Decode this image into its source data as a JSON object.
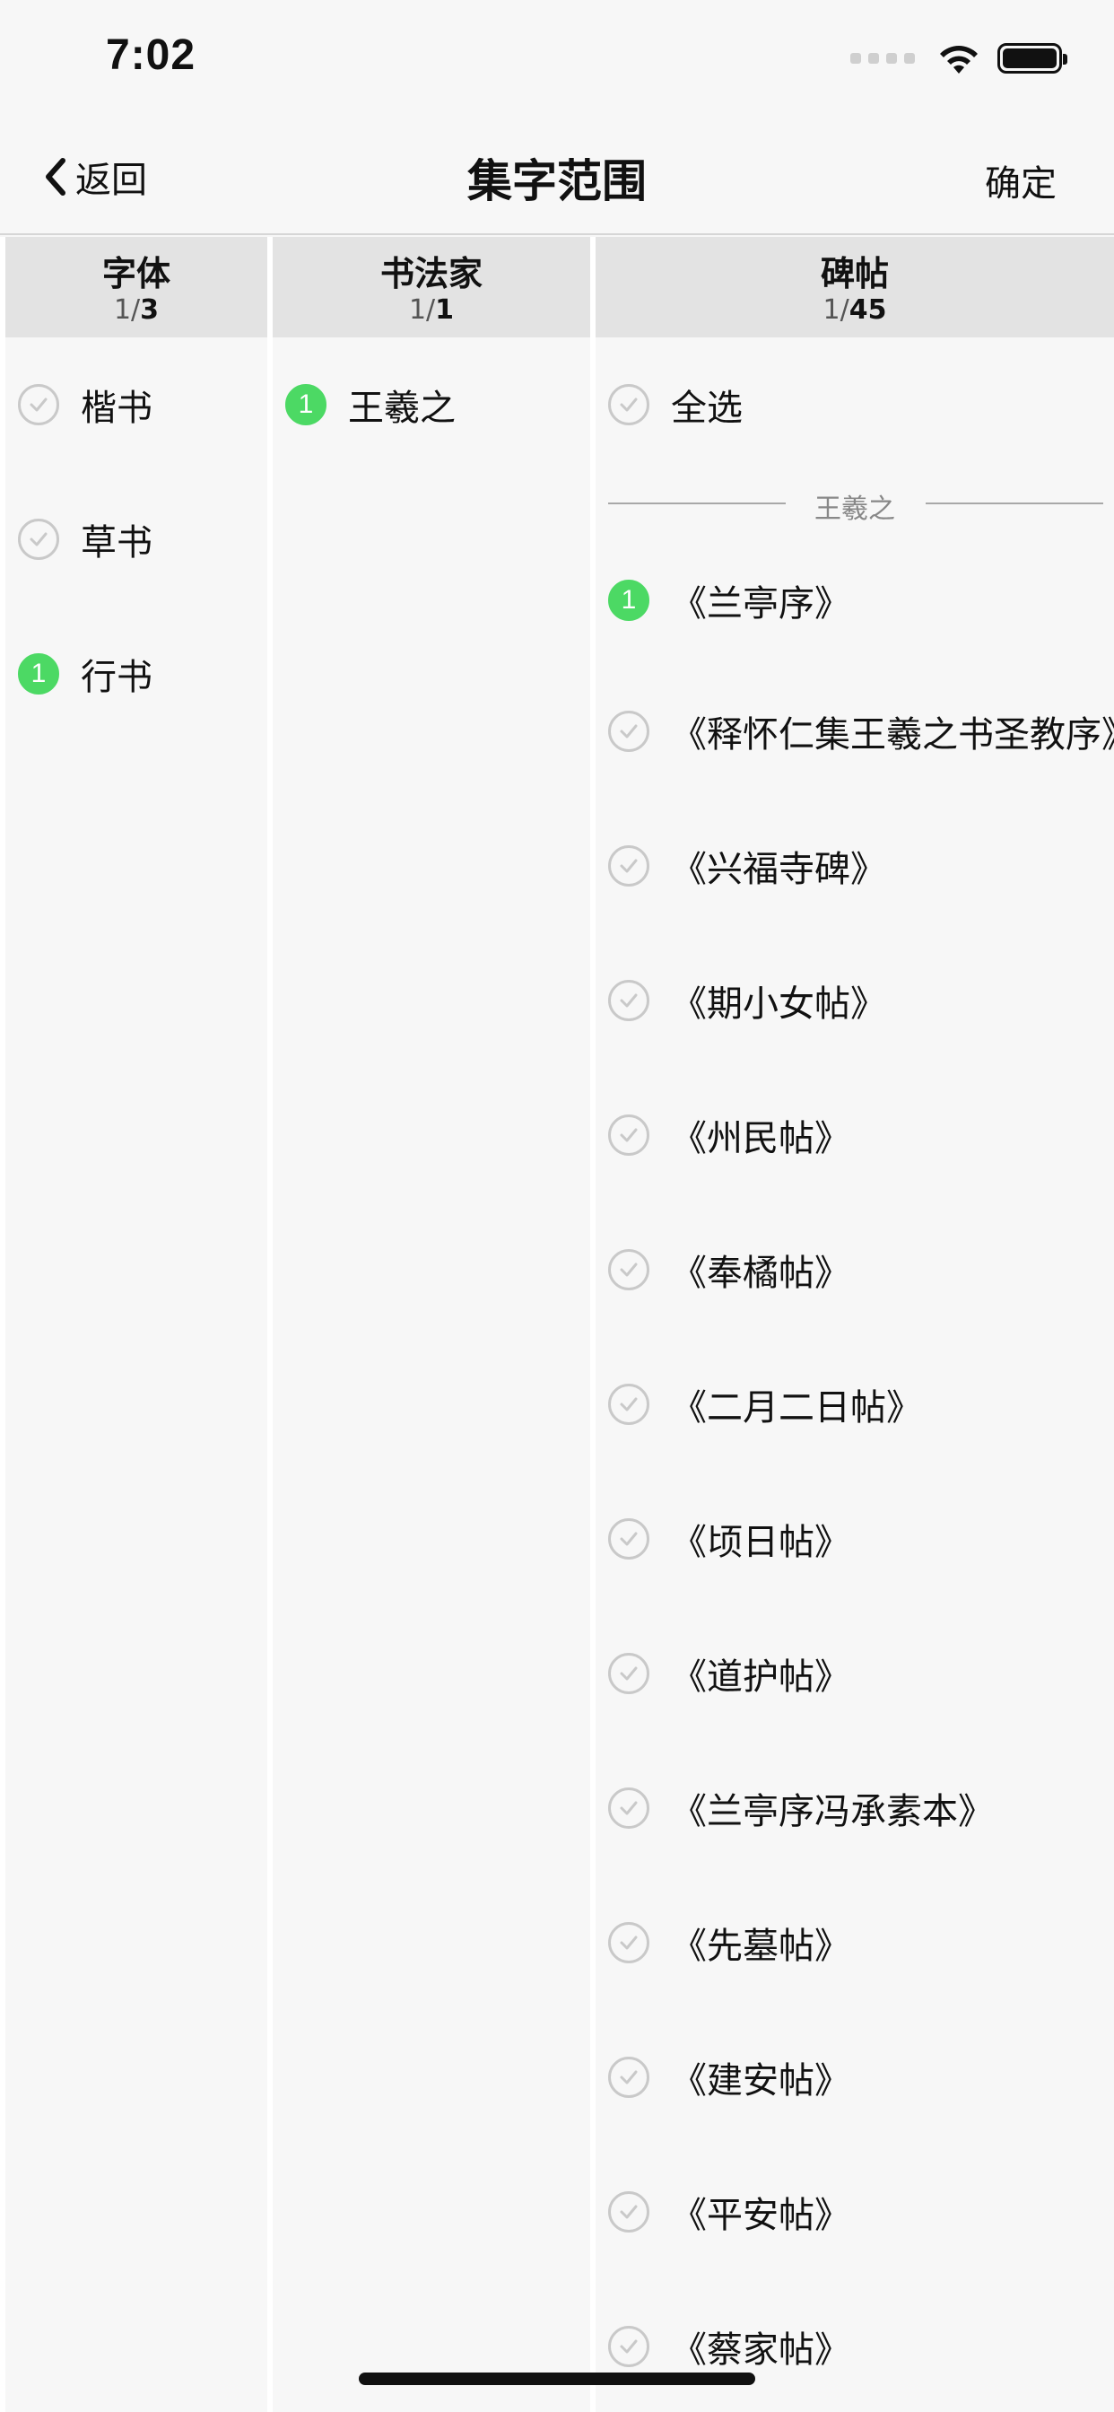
{
  "status_bar": {
    "time": "7:02"
  },
  "nav": {
    "back_label": "返回",
    "title": "集字范围",
    "confirm_label": "确定"
  },
  "columns": {
    "font_style": {
      "title": "字体",
      "selected": "1",
      "total": "3",
      "items": [
        {
          "label": "楷书",
          "selected": false
        },
        {
          "label": "草书",
          "selected": false
        },
        {
          "label": "行书",
          "selected": true,
          "badge": "1"
        }
      ]
    },
    "calligrapher": {
      "title": "书法家",
      "selected": "1",
      "total": "1",
      "items": [
        {
          "label": "王羲之",
          "selected": true,
          "badge": "1"
        }
      ]
    },
    "rubbing": {
      "title": "碑帖",
      "selected": "1",
      "total": "45",
      "select_all_label": "全选",
      "group_label": "王羲之",
      "items": [
        {
          "label": "《兰亭序》",
          "selected": true,
          "badge": "1"
        },
        {
          "label": "《释怀仁集王羲之书圣教序》",
          "selected": false
        },
        {
          "label": "《兴福寺碑》",
          "selected": false
        },
        {
          "label": "《期小女帖》",
          "selected": false
        },
        {
          "label": "《州民帖》",
          "selected": false
        },
        {
          "label": "《奉橘帖》",
          "selected": false
        },
        {
          "label": "《二月二日帖》",
          "selected": false
        },
        {
          "label": "《顷日帖》",
          "selected": false
        },
        {
          "label": "《道护帖》",
          "selected": false
        },
        {
          "label": "《兰亭序冯承素本》",
          "selected": false
        },
        {
          "label": "《先墓帖》",
          "selected": false
        },
        {
          "label": "《建安帖》",
          "selected": false
        },
        {
          "label": "《平安帖》",
          "selected": false
        },
        {
          "label": "《蔡家帖》",
          "selected": false
        }
      ]
    }
  },
  "colors": {
    "selected_green": "#4cd964",
    "header_bg": "#e3e3e3",
    "unchecked_gray": "#c9c9c9"
  }
}
